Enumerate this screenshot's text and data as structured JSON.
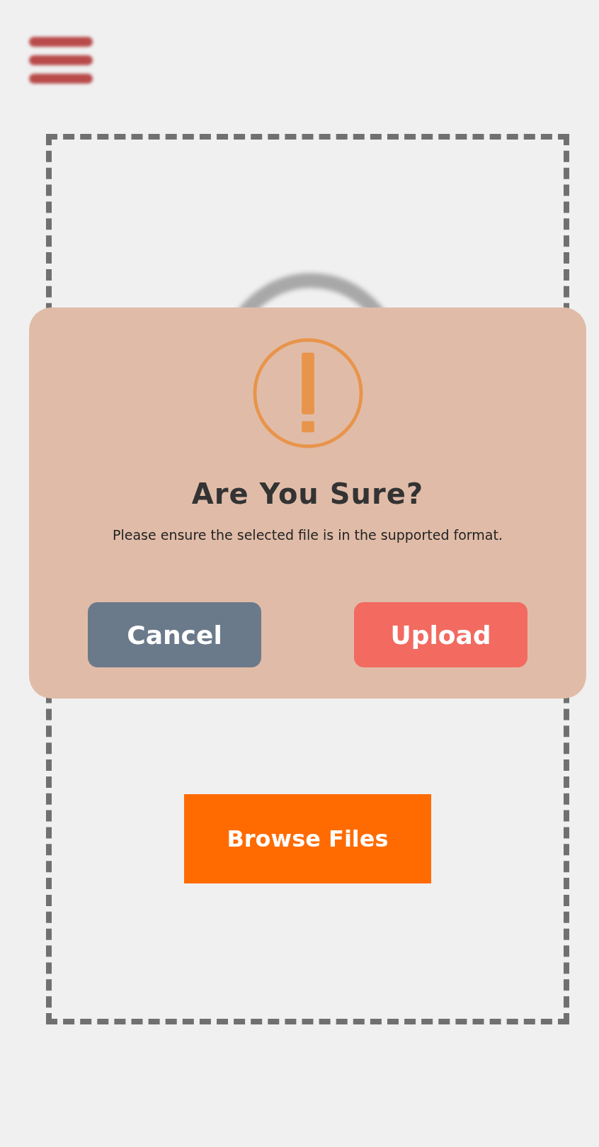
{
  "dropzone": {
    "browse_button": "Browse Files"
  },
  "dialog": {
    "title": "Are You Sure?",
    "message": "Please ensure the selected file is in the supported format.",
    "buttons": [
      {
        "label": "Cancel",
        "kind": "secondary"
      },
      {
        "label": "Upload",
        "kind": "primary"
      }
    ]
  }
}
